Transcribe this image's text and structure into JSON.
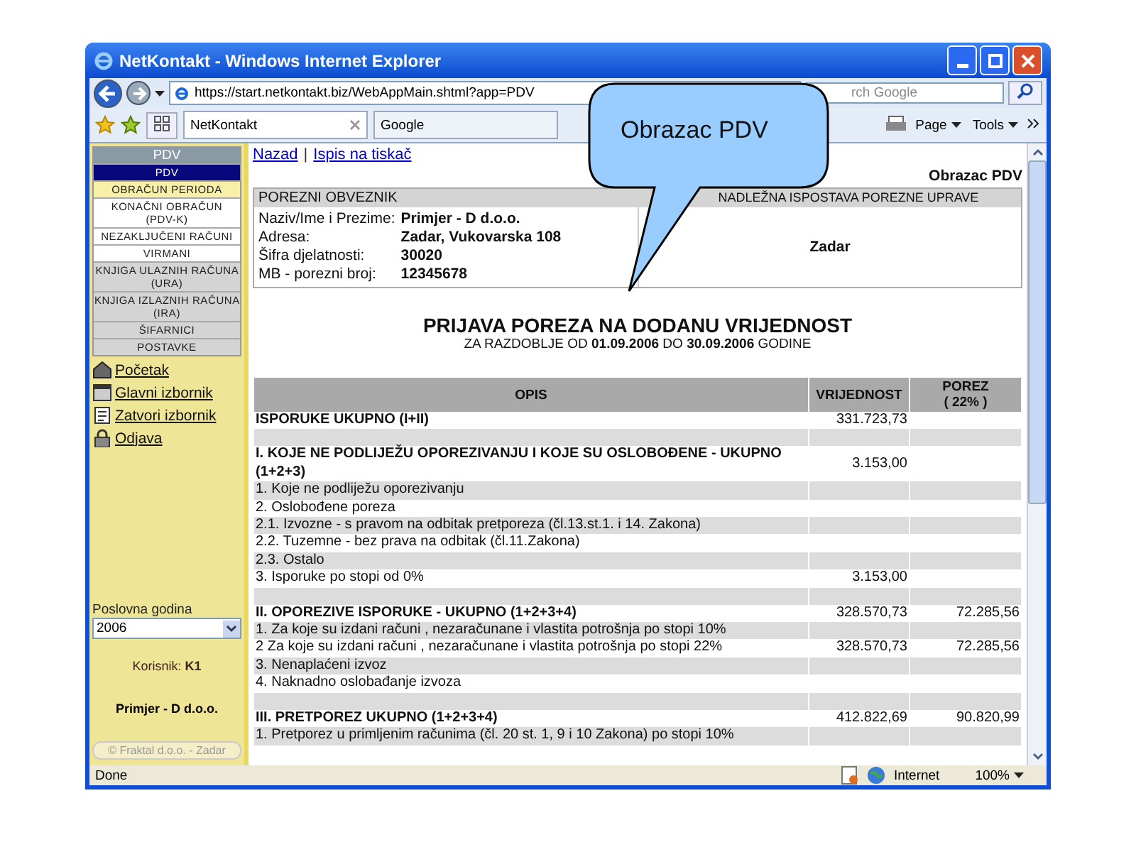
{
  "window": {
    "title": "NetKontakt - Windows Internet Explorer"
  },
  "address_bar": {
    "url": "https://start.netkontakt.biz/WebAppMain.shtml?app=PDV"
  },
  "search": {
    "placeholder": "rch Google"
  },
  "tabs": [
    {
      "label": "NetKontakt",
      "selected": true
    },
    {
      "label": "Google",
      "selected": false
    }
  ],
  "toolbar": {
    "page": "Page",
    "tools": "Tools"
  },
  "callout": {
    "text": "Obrazac PDV"
  },
  "sidebar": {
    "header": "PDV",
    "menu": [
      {
        "label": "PDV",
        "selected": true,
        "hovered": false,
        "disabled": false
      },
      {
        "label": "OBRAČUN PERIODA",
        "selected": false,
        "hovered": true,
        "disabled": false
      },
      {
        "label": "KONAČNI OBRAČUN (PDV-K)",
        "selected": false,
        "hovered": false,
        "disabled": false
      },
      {
        "label": "NEZAKLJUČENI RAČUNI",
        "selected": false,
        "hovered": false,
        "disabled": false
      },
      {
        "label": "VIRMANI",
        "selected": false,
        "hovered": false,
        "disabled": false
      },
      {
        "label": "KNJIGA ULAZNIH RAČUNA (URA)",
        "selected": false,
        "hovered": false,
        "disabled": true
      },
      {
        "label": "KNJIGA IZLAZNIH RAČUNA (IRA)",
        "selected": false,
        "hovered": false,
        "disabled": true
      },
      {
        "label": "ŠIFARNICI",
        "selected": false,
        "hovered": false,
        "disabled": true
      },
      {
        "label": "POSTAVKE",
        "selected": false,
        "hovered": false,
        "disabled": true
      }
    ],
    "links": [
      {
        "label": "Početak",
        "kind": "home"
      },
      {
        "label": "Glavni izbornik",
        "kind": "menu"
      },
      {
        "label": "Zatvori izbornik",
        "kind": "close"
      },
      {
        "label": "Odjava",
        "kind": "logout"
      }
    ],
    "year_label": "Poslovna godina",
    "year": "2006",
    "user_label": "Korisnik:",
    "user": "K1",
    "company": "Primjer - D d.o.o.",
    "copyright": "© Fraktal d.o.o. - Zadar"
  },
  "content": {
    "links": [
      "Nazad",
      "Ispis na tiskač"
    ],
    "separator": "|",
    "form_name": "Obrazac PDV",
    "taxpayer": {
      "heading": "POREZNI OBVEZNIK",
      "fields": [
        {
          "label": "Naziv/Ime i Prezime:",
          "value": "Primjer - D d.o.o."
        },
        {
          "label": "Adresa:",
          "value": "Zadar, Vukovarska 108"
        },
        {
          "label": "Šifra djelatnosti:",
          "value": "30020"
        },
        {
          "label": "MB - porezni broj:",
          "value": "12345678"
        }
      ]
    },
    "office": {
      "heading": "NADLEŽNA ISPOSTAVA POREZNE UPRAVE",
      "value": "Zadar"
    },
    "title": "PRIJAVA POREZA NA DODANU VRIJEDNOST",
    "subtitle": "ZA RAZDOBLJE OD **01.09.2006** DO **30.09.2006** GODINE",
    "table": {
      "columns": [
        {
          "label": "OPIS"
        },
        {
          "label": "VRIJEDNOST"
        },
        {
          "label": "POREZ",
          "sub": "( 22% )"
        }
      ],
      "rows": [
        {
          "kind": "total",
          "description": "ISPORUKE UKUPNO (I+II)",
          "value": "331.723,73"
        },
        {
          "kind": "spacer"
        },
        {
          "kind": "total",
          "description": "I. KOJE NE PODLIJEŽU OPOREZIVANJU I KOJE SU OSLOBOĐENE - UKUPNO (1+2+3)",
          "value": "3.153,00"
        },
        {
          "kind": "item",
          "description": "1. Koje ne podliježu oporezivanju"
        },
        {
          "kind": "item",
          "description": "2. Oslobođene poreza"
        },
        {
          "kind": "item",
          "description": "2.1. Izvozne - s pravom na odbitak pretporeza (čl.13.st.1. i 14. Zakona)"
        },
        {
          "kind": "item",
          "description": "2.2. Tuzemne - bez prava na odbitak (čl.11.Zakona)"
        },
        {
          "kind": "item",
          "description": "2.3. Ostalo"
        },
        {
          "kind": "item",
          "description": "3. Isporuke po stopi od 0%",
          "value": "3.153,00"
        },
        {
          "kind": "spacer"
        },
        {
          "kind": "total",
          "description": "II. OPOREZIVE ISPORUKE - UKUPNO (1+2+3+4)",
          "value": "328.570,73",
          "tax": "72.285,56"
        },
        {
          "kind": "item",
          "description": "1. Za koje su izdani računi , nezaračunane i vlastita potrošnja po stopi 10%"
        },
        {
          "kind": "item",
          "description": "2 Za koje su izdani računi , nezaračunane i vlastita potrošnja po stopi 22%",
          "value": "328.570,73",
          "tax": "72.285,56"
        },
        {
          "kind": "item",
          "description": "3. Nenaplaćeni izvoz"
        },
        {
          "kind": "item",
          "description": "4. Naknadno oslobađanje izvoza"
        },
        {
          "kind": "spacer"
        },
        {
          "kind": "total",
          "description": "III. PRETPOREZ UKUPNO (1+2+3+4)",
          "value": "412.822,69",
          "tax": "90.820,99"
        },
        {
          "kind": "item",
          "description": "1. Pretporez u primljenim računima (čl. 20 st. 1, 9 i 10 Zakona) po stopi 10%"
        }
      ]
    }
  },
  "status_bar": {
    "text": "Done",
    "zone": "Internet",
    "zoom": "100%"
  }
}
